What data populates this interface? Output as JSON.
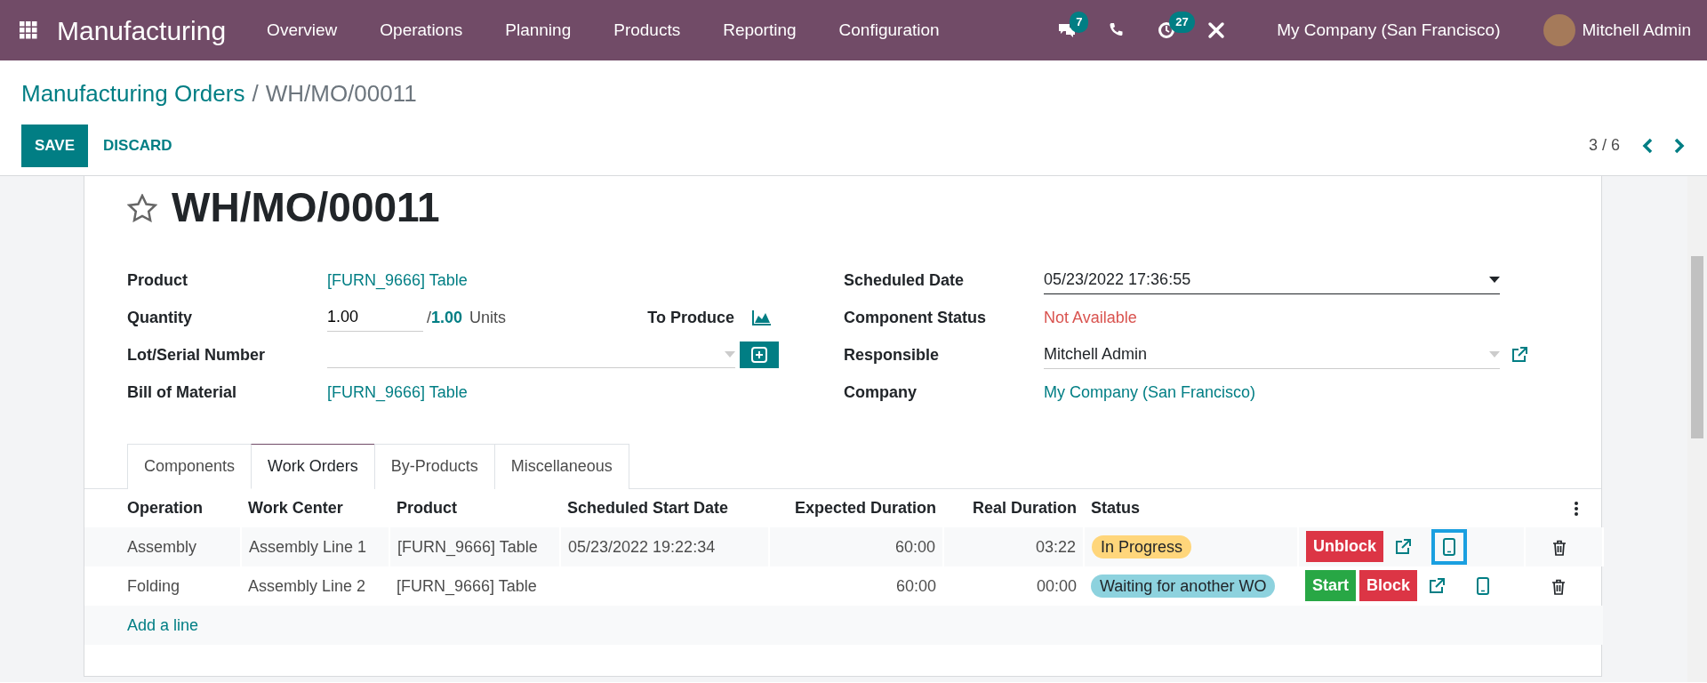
{
  "navbar": {
    "app_name": "Manufacturing",
    "menu": [
      "Overview",
      "Operations",
      "Planning",
      "Products",
      "Reporting",
      "Configuration"
    ],
    "systray": [
      {
        "kind": "chat",
        "badge": "7"
      },
      {
        "kind": "phone"
      },
      {
        "kind": "activity",
        "badge": "27"
      },
      {
        "kind": "tools"
      }
    ],
    "company": "My Company (San Francisco)",
    "user": "Mitchell Admin"
  },
  "breadcrumb": {
    "parent": "Manufacturing Orders",
    "separator": "/",
    "current": "WH/MO/00011"
  },
  "buttons": [
    {
      "label": "SAVE",
      "kind": "primary"
    },
    {
      "label": "DISCARD",
      "kind": "link"
    }
  ],
  "pager": "3 / 6",
  "record": {
    "starred": false,
    "title": "WH/MO/00011"
  },
  "left_fields": [
    {
      "label": "Product",
      "kind": "link",
      "value": "[FURN_9666] Table"
    },
    {
      "label": "Quantity",
      "kind": "quantity",
      "value": "1.00",
      "separator": "/",
      "produced": "1.00",
      "unit": "Units",
      "extra_label": "To Produce"
    },
    {
      "label": "Lot/Serial Number",
      "kind": "select_create"
    },
    {
      "label": "Bill of Material",
      "kind": "link",
      "value": "[FURN_9666] Table"
    }
  ],
  "right_fields": [
    {
      "label": "Scheduled Date",
      "kind": "date",
      "value": "05/23/2022 17:36:55"
    },
    {
      "label": "Component Status",
      "kind": "warning",
      "value": "Not Available"
    },
    {
      "label": "Responsible",
      "kind": "select_open",
      "value": "Mitchell Admin"
    },
    {
      "label": "Company",
      "kind": "link",
      "value": "My Company (San Francisco)"
    }
  ],
  "tabs": [
    {
      "label": "Components",
      "selected": false
    },
    {
      "label": "Work Orders",
      "selected": true
    },
    {
      "label": "By-Products",
      "selected": false
    },
    {
      "label": "Miscellaneous",
      "selected": false
    }
  ],
  "table": {
    "columns": [
      "Operation",
      "Work Center",
      "Product",
      "Scheduled Start Date",
      "Expected Duration",
      "Real Duration",
      "Status"
    ],
    "rows": [
      {
        "operation": "Assembly",
        "work_center": "Assembly Line 1",
        "product": "[FURN_9666] Table",
        "scheduled_start": "05/23/2022 19:22:34",
        "expected": "60:00",
        "real": "03:22",
        "status": {
          "text": "In Progress",
          "color": "#ffd67b"
        },
        "buttons": [
          {
            "label": "Unblock",
            "kind": "danger"
          }
        ],
        "tablet_highlighted": true
      },
      {
        "operation": "Folding",
        "work_center": "Assembly Line 2",
        "product": "[FURN_9666] Table",
        "expected": "60:00",
        "real": "00:00",
        "status": {
          "text": "Waiting for another WO",
          "color": "#8dd2de"
        },
        "buttons": [
          {
            "label": "Start",
            "kind": "success"
          },
          {
            "label": "Block",
            "kind": "danger"
          }
        ],
        "tablet_highlighted": false
      }
    ],
    "add_line": "Add a line"
  }
}
